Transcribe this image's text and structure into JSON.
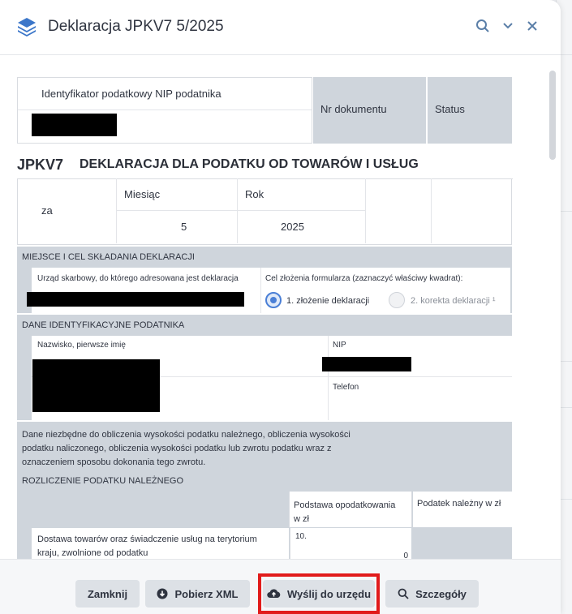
{
  "header": {
    "title": "Deklaracja JPKV7 5/2025"
  },
  "top_table": {
    "nip_label": "Identyfikator podatkowy NIP podatnika",
    "nr_dokumentu": "Nr dokumentu",
    "status": "Status"
  },
  "form_title": {
    "code": "JPKV7",
    "name": "DEKLARACJA DLA PODATKU OD TOWARÓW I USŁUG"
  },
  "period": {
    "za": "za",
    "month_label": "Miesiąc",
    "year_label": "Rok",
    "month_value": "5",
    "year_value": "2025"
  },
  "section_place": {
    "header": "MIEJSCE I CEL SKŁADANIA DEKLARACJI",
    "office_label": "Urząd skarbowy, do którego adresowana jest deklaracja",
    "purpose_label": "Cel złożenia formularza (zaznaczyć właściwy kwadrat):",
    "option1": "1. złożenie deklaracji",
    "option2": "2. korekta deklaracji ¹"
  },
  "section_ident": {
    "header": "DANE IDENTYFIKACYJNE PODATNIKA",
    "name_label": "Nazwisko, pierwsze imię",
    "nip_label": "NIP",
    "phone_label": "Telefon"
  },
  "section_calc": {
    "intro_line1": "Dane niezbędne do obliczenia wysokości podatku należnego, obliczenia wysokości",
    "intro_line2": "podatku naliczonego, obliczenia wysokości podatku lub zwrotu podatku wraz z",
    "intro_line3": "oznaczeniem sposobu dokonania tego zwrotu.",
    "subheader": "ROZLICZENIE PODATKU NALEŻNEGO",
    "col_base_line1": "Podstawa opodatkowania",
    "col_base_line2": "w zł",
    "col_tax": "Podatek należny w zł",
    "row1_line1": "Dostawa towarów oraz świadczenie usług na terytorium",
    "row1_line2": "kraju, zwolnione od podatku",
    "row1_field_no": "10.",
    "row1_value": "0"
  },
  "footer": {
    "close": "Zamknij",
    "download_xml": "Pobierz XML",
    "send": "Wyślij do urzędu",
    "details": "Szczegóły"
  },
  "colors": {
    "accent": "#4a7fd6",
    "section_grey": "#cfd5dc",
    "highlight": "#e11b1b"
  }
}
